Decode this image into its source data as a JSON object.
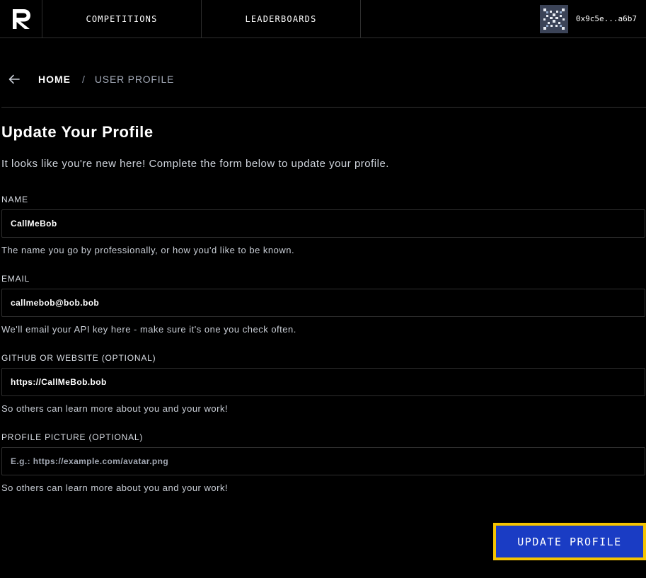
{
  "nav": {
    "logo_letter": "R",
    "links": [
      {
        "label": "COMPETITIONS"
      },
      {
        "label": "LEADERBOARDS"
      }
    ],
    "wallet_address": "0x9c5e...a6b7"
  },
  "breadcrumb": {
    "home": "HOME",
    "separator": "/",
    "current": "USER PROFILE"
  },
  "header": {
    "title": "Update Your Profile",
    "subtitle": "It looks like you're new here! Complete the form below to update your profile."
  },
  "form": {
    "fields": [
      {
        "label": "NAME",
        "value": "CallMeBob",
        "placeholder": "",
        "help": "The name you go by professionally, or how you'd like to be known."
      },
      {
        "label": "EMAIL",
        "value": "callmebob@bob.bob",
        "placeholder": "",
        "help": "We'll email your API key here - make sure it's one you check often."
      },
      {
        "label": "GITHUB OR WEBSITE (OPTIONAL)",
        "value": "https://CallMeBob.bob",
        "placeholder": "",
        "help": "So others can learn more about you and your work!"
      },
      {
        "label": "PROFILE PICTURE (OPTIONAL)",
        "value": "",
        "placeholder": "E.g.: https://example.com/avatar.png",
        "help": "So others can learn more about you and your work!"
      }
    ],
    "submit_label": "UPDATE PROFILE"
  },
  "icons": {
    "logo": "logo-icon",
    "avatar": "wallet-avatar-icon",
    "back": "arrow-left-icon"
  },
  "colors": {
    "background": "#000000",
    "button": "#1a3cc4",
    "button_focus_ring": "#f5c400",
    "border": "#2f2f2f"
  }
}
